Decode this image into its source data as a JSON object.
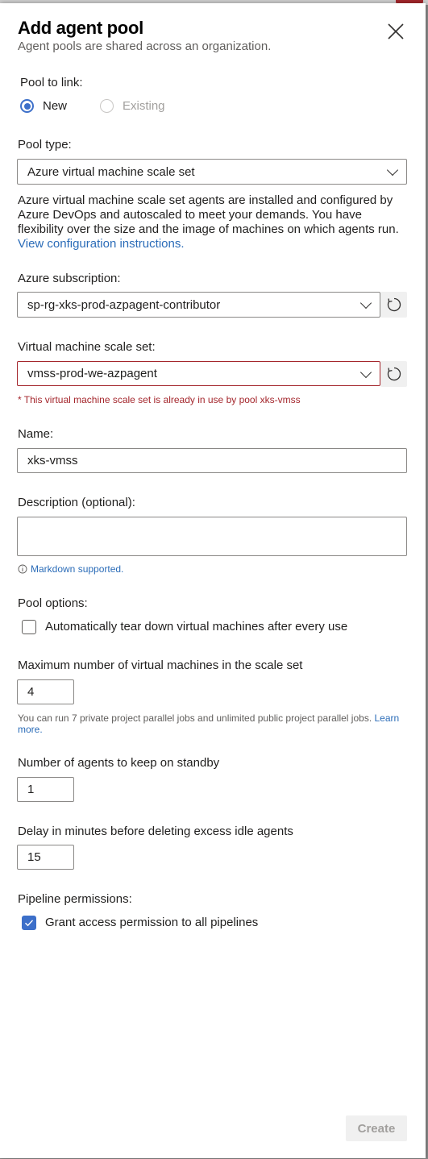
{
  "header": {
    "title": "Add agent pool",
    "subtitle": "Agent pools are shared across an organization."
  },
  "pool_to_link": {
    "label": "Pool to link:",
    "options": [
      {
        "label": "New",
        "selected": true
      },
      {
        "label": "Existing",
        "selected": false
      }
    ]
  },
  "pool_type": {
    "label": "Pool type:",
    "value": "Azure virtual machine scale set",
    "description": "Azure virtual machine scale set agents are installed and configured by Azure DevOps and autoscaled to meet your demands. You have flexibility over the size and the image of machines on which agents run.",
    "link": "View configuration instructions."
  },
  "azure_subscription": {
    "label": "Azure subscription:",
    "value": "sp-rg-xks-prod-azpagent-contributor"
  },
  "vmss": {
    "label": "Virtual machine scale set:",
    "value": "vmss-prod-we-azpagent",
    "error": "* This virtual machine scale set is already in use by pool xks-vmss"
  },
  "name": {
    "label": "Name:",
    "value": "xks-vmss"
  },
  "description": {
    "label": "Description (optional):",
    "value": "",
    "hint": "Markdown supported."
  },
  "pool_options": {
    "label": "Pool options:",
    "teardown_label": "Automatically tear down virtual machines after every use",
    "teardown_checked": false
  },
  "max_vms": {
    "label": "Maximum number of virtual machines in the scale set",
    "value": "4",
    "note": "You can run 7 private project parallel jobs and unlimited public project parallel jobs.",
    "note_link": "Learn more."
  },
  "standby": {
    "label": "Number of agents to keep on standby",
    "value": "1"
  },
  "delay": {
    "label": "Delay in minutes before deleting excess idle agents",
    "value": "15"
  },
  "pipeline_permissions": {
    "label": "Pipeline permissions:",
    "grant_label": "Grant access permission to all pipelines",
    "grant_checked": true
  },
  "footer": {
    "create_label": "Create"
  },
  "colors": {
    "accent": "#3c6fc9",
    "error": "#a4262c",
    "link": "#2b6cb8"
  }
}
